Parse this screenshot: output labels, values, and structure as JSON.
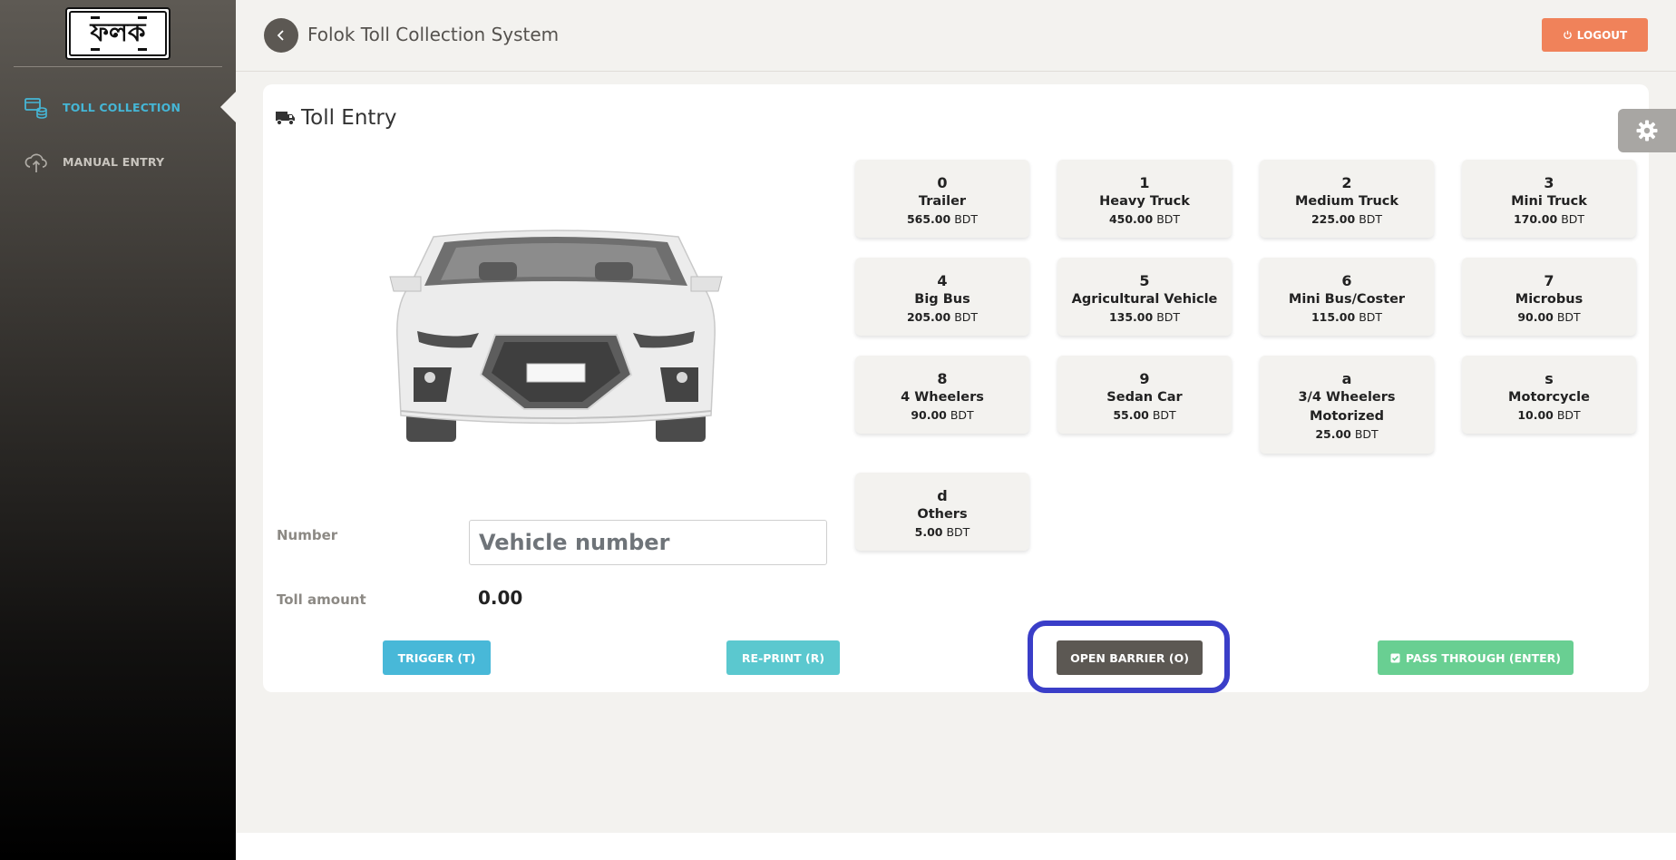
{
  "app": {
    "title": "Folok Toll Collection System",
    "logo_text": "ফলক",
    "logout_label": "LOGOUT"
  },
  "sidebar": {
    "items": [
      {
        "label": "TOLL COLLECTION",
        "icon": "toll-collection-icon",
        "active": true
      },
      {
        "label": "MANUAL ENTRY",
        "icon": "cloud-upload-icon",
        "active": false
      }
    ]
  },
  "main": {
    "section_title": "Toll Entry",
    "tiles": [
      {
        "key": "0",
        "name": "Trailer",
        "amount": "565.00",
        "currency": "BDT"
      },
      {
        "key": "1",
        "name": "Heavy Truck",
        "amount": "450.00",
        "currency": "BDT"
      },
      {
        "key": "2",
        "name": "Medium Truck",
        "amount": "225.00",
        "currency": "BDT"
      },
      {
        "key": "3",
        "name": "Mini Truck",
        "amount": "170.00",
        "currency": "BDT"
      },
      {
        "key": "4",
        "name": "Big Bus",
        "amount": "205.00",
        "currency": "BDT"
      },
      {
        "key": "5",
        "name": "Agricultural Vehicle",
        "amount": "135.00",
        "currency": "BDT"
      },
      {
        "key": "6",
        "name": "Mini Bus/Coster",
        "amount": "115.00",
        "currency": "BDT"
      },
      {
        "key": "7",
        "name": "Microbus",
        "amount": "90.00",
        "currency": "BDT"
      },
      {
        "key": "8",
        "name": "4 Wheelers",
        "amount": "90.00",
        "currency": "BDT"
      },
      {
        "key": "9",
        "name": "Sedan Car",
        "amount": "55.00",
        "currency": "BDT"
      },
      {
        "key": "a",
        "name": "3/4 Wheelers Motorized",
        "amount": "25.00",
        "currency": "BDT"
      },
      {
        "key": "s",
        "name": "Motorcycle",
        "amount": "10.00",
        "currency": "BDT"
      },
      {
        "key": "d",
        "name": "Others",
        "amount": "5.00",
        "currency": "BDT"
      }
    ],
    "form": {
      "number_label": "Number",
      "number_placeholder": "Vehicle number",
      "number_value": "",
      "toll_label": "Toll amount",
      "toll_value": "0.00"
    },
    "actions": {
      "trigger": "TRIGGER (T)",
      "reprint": "RE-PRINT (R)",
      "open_barrier": "OPEN BARRIER (O)",
      "pass_through": "PASS THROUGH (ENTER)"
    }
  },
  "colors": {
    "accent_blue": "#45b6d6",
    "logout": "#f0825a",
    "highlight": "#3a3ec8",
    "pass_green": "#69cf92"
  }
}
